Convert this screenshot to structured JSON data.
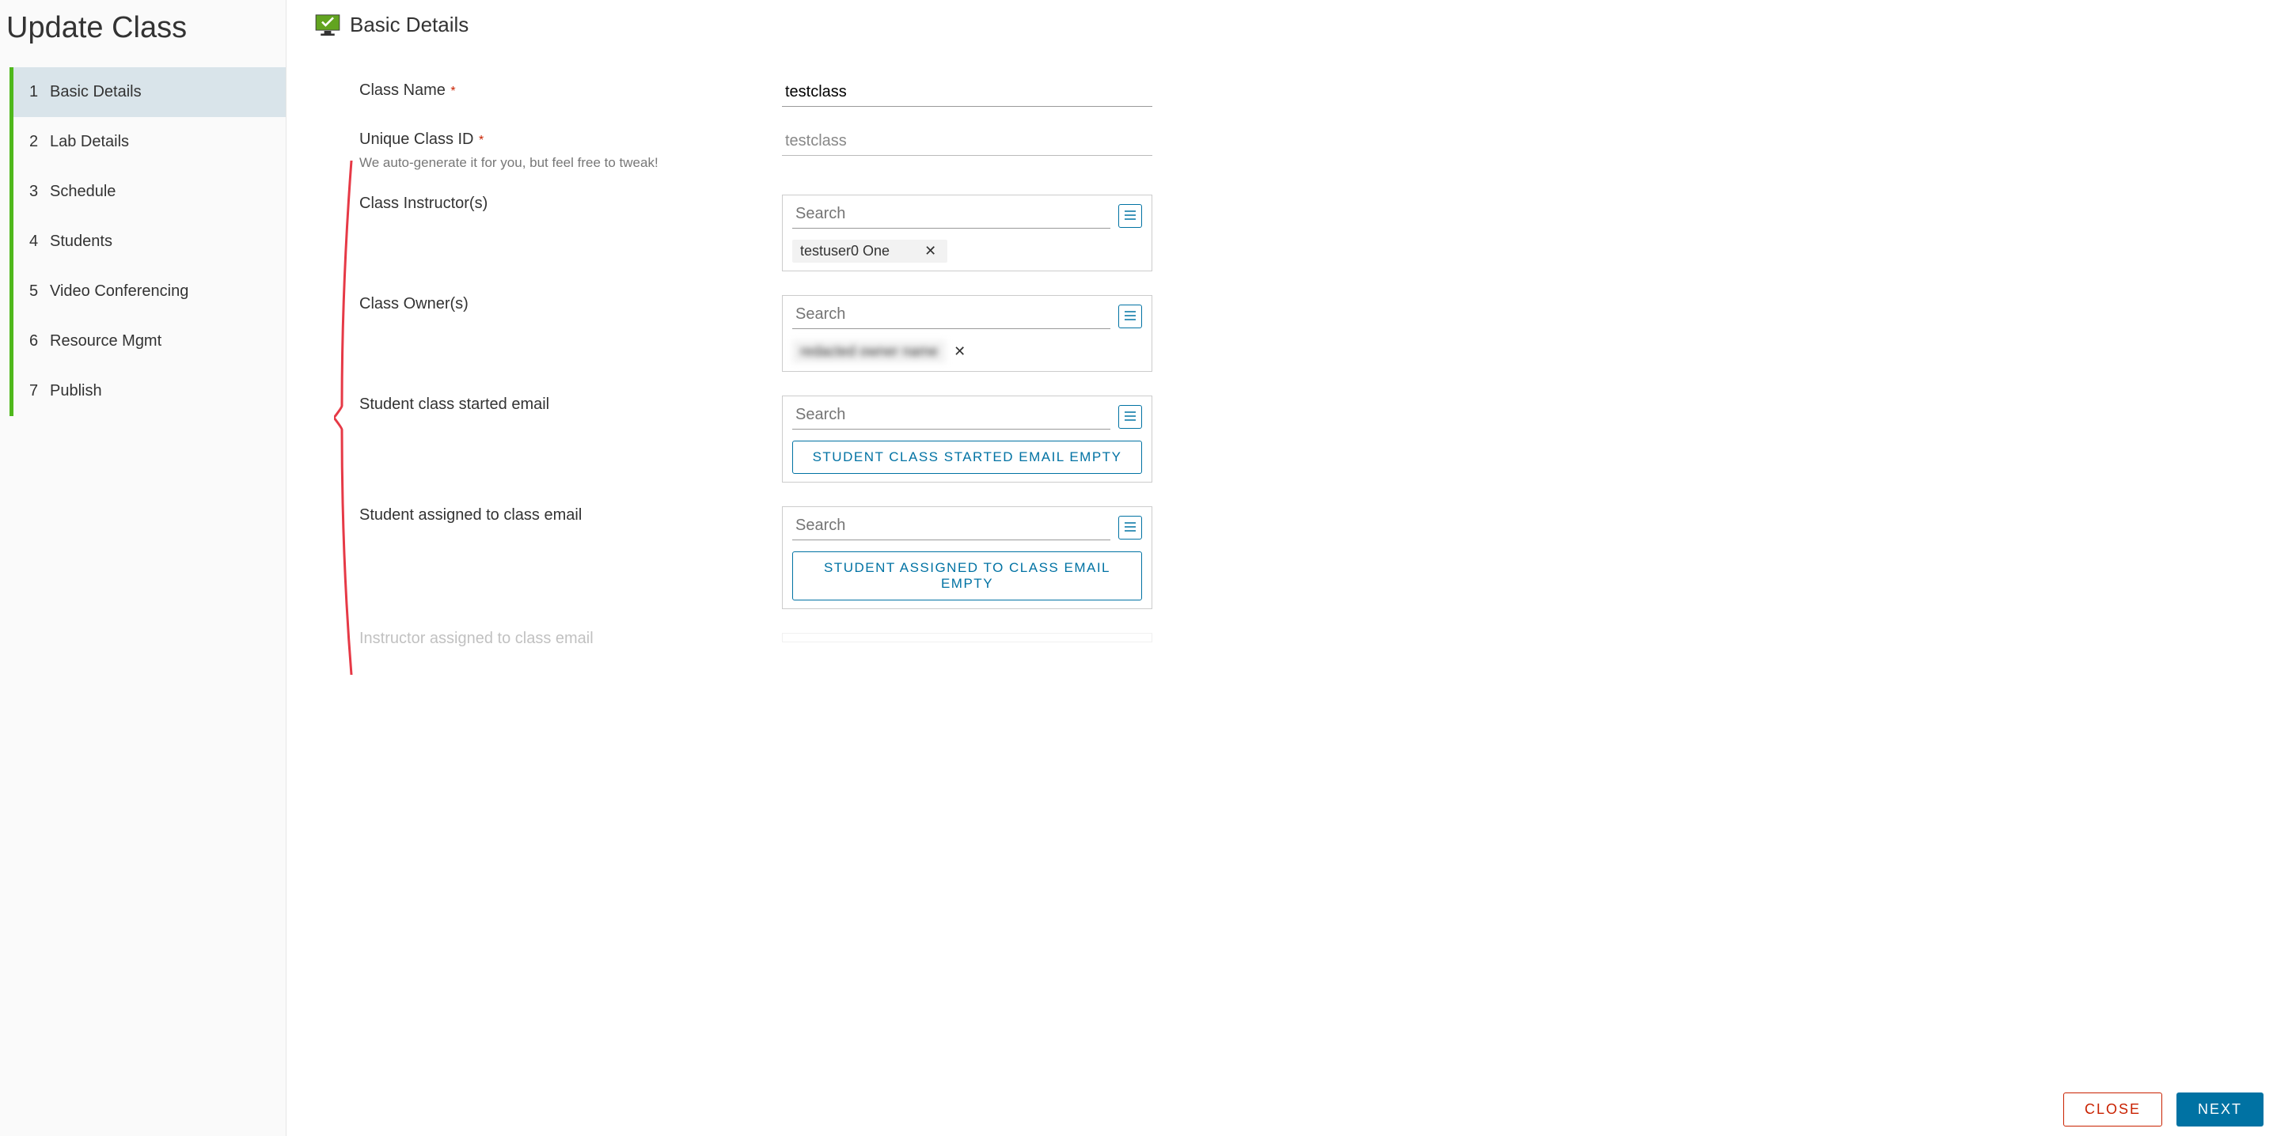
{
  "page": {
    "title": "Update Class"
  },
  "wizard": {
    "items": [
      {
        "num": "1",
        "label": "Basic Details",
        "active": true
      },
      {
        "num": "2",
        "label": "Lab Details",
        "active": false
      },
      {
        "num": "3",
        "label": "Schedule",
        "active": false
      },
      {
        "num": "4",
        "label": "Students",
        "active": false
      },
      {
        "num": "5",
        "label": "Video Conferencing",
        "active": false
      },
      {
        "num": "6",
        "label": "Resource Mgmt",
        "active": false
      },
      {
        "num": "7",
        "label": "Publish",
        "active": false
      }
    ]
  },
  "header": {
    "title": "Basic Details"
  },
  "form": {
    "class_name": {
      "label": "Class Name",
      "required": true,
      "value": "testclass"
    },
    "unique_id": {
      "label": "Unique Class ID",
      "required": true,
      "value": "testclass",
      "helper": "We auto-generate it for you, but feel free to tweak!"
    },
    "instructors": {
      "label": "Class Instructor(s)",
      "search_placeholder": "Search",
      "chips": [
        "testuser0 One"
      ]
    },
    "owners": {
      "label": "Class Owner(s)",
      "search_placeholder": "Search",
      "chips_redacted": [
        "redacted owner name"
      ]
    },
    "student_started_email": {
      "label": "Student class started email",
      "search_placeholder": "Search",
      "empty_text": "STUDENT CLASS STARTED EMAIL EMPTY"
    },
    "student_assigned_email": {
      "label": "Student assigned to class email",
      "search_placeholder": "Search",
      "empty_text": "STUDENT ASSIGNED TO CLASS EMAIL EMPTY"
    },
    "instructor_assigned_email": {
      "label": "Instructor assigned to class email"
    }
  },
  "footer": {
    "close": "CLOSE",
    "next": "NEXT"
  }
}
